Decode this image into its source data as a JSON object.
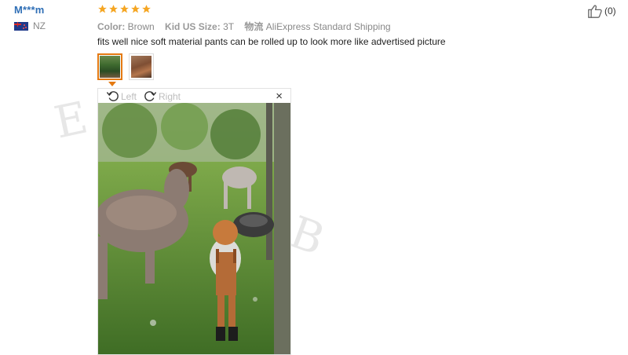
{
  "reviewer": {
    "name": "M***m",
    "country": "NZ"
  },
  "rating": {
    "stars": 5
  },
  "meta": {
    "color_label": "Color:",
    "color_value": "Brown",
    "size_label": "Kid US Size:",
    "size_value": "3T",
    "shipping_label": "物流",
    "shipping_value": "AliExpress Standard Shipping"
  },
  "review": {
    "text": "fits well nice soft material pants can be rolled up to look more like advertised picture"
  },
  "helpful": {
    "count": "(0)"
  },
  "viewer": {
    "rotate_left": "Left",
    "rotate_right": "Right",
    "close": "×"
  },
  "watermark": {
    "part1": "E",
    "part2": "B"
  },
  "colors": {
    "accent": "#e47911",
    "star": "#f5a623",
    "name": "#2f6fb6"
  }
}
